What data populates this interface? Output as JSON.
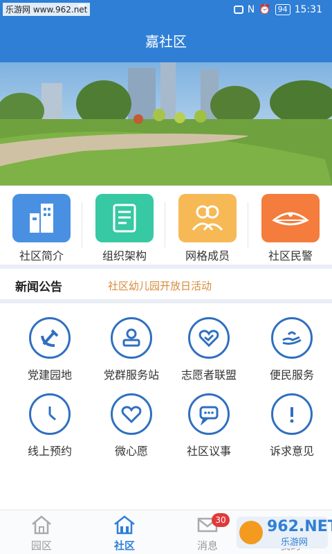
{
  "status_bar": {
    "watermark": "乐游网 www.962.net",
    "time": "15:31",
    "battery": "94"
  },
  "header": {
    "title": "嘉社区"
  },
  "quick_links": [
    {
      "label": "社区简介",
      "color": "#4a90e2"
    },
    {
      "label": "组织架构",
      "color": "#36c9a3"
    },
    {
      "label": "网格成员",
      "color": "#f7b955"
    },
    {
      "label": "社区民警",
      "color": "#f47c3c"
    }
  ],
  "news": {
    "title": "新闻公告",
    "headline": "社区幼儿园开放日活动"
  },
  "services": [
    {
      "label": "党建园地",
      "icon": "party-emblem-icon"
    },
    {
      "label": "党群服务站",
      "icon": "person-icon"
    },
    {
      "label": "志愿者联盟",
      "icon": "heart-shield-icon"
    },
    {
      "label": "便民服务",
      "icon": "hand-icon"
    },
    {
      "label": "线上预约",
      "icon": "clock-icon"
    },
    {
      "label": "微心愿",
      "icon": "heart-icon"
    },
    {
      "label": "社区议事",
      "icon": "chat-icon"
    },
    {
      "label": "诉求意见",
      "icon": "exclamation-icon"
    }
  ],
  "tabs": [
    {
      "label": "园区",
      "icon": "home-icon"
    },
    {
      "label": "社区",
      "icon": "community-icon"
    },
    {
      "label": "消息",
      "icon": "mail-icon",
      "badge": "30"
    },
    {
      "label": "我的",
      "icon": "user-icon"
    }
  ],
  "corner_watermark": {
    "brand": "962.NET",
    "text": "乐游网"
  },
  "accent": "#2f7fd6"
}
